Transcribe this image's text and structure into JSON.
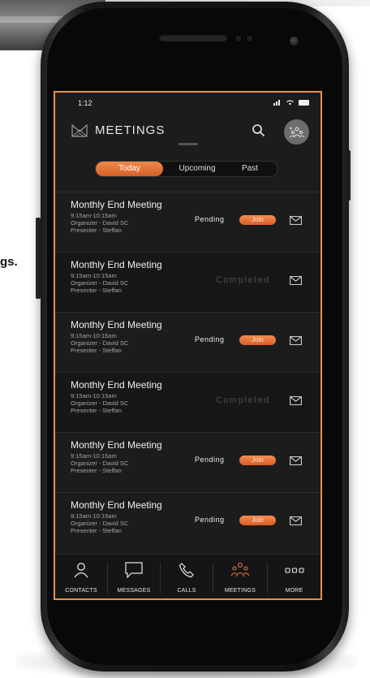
{
  "background": {
    "side_text": "gs."
  },
  "status_bar": {
    "time": "1:12"
  },
  "header": {
    "title": "MEETINGS"
  },
  "tabs": [
    {
      "label": "Today"
    },
    {
      "label": "Upcoming"
    },
    {
      "label": "Past"
    }
  ],
  "meetings": [
    {
      "title": "Monthly End Meeting",
      "time": "9:15am-10:15am",
      "organizer": "Organizer - David SC",
      "presenter": "Presenter - Steffan",
      "status": "Pending",
      "action": "Join"
    },
    {
      "title": "Monthly End Meeting",
      "time": "9:15am-10:15am",
      "organizer": "Organizer - David SC",
      "presenter": "Presenter - Steffan",
      "status": "Completed"
    },
    {
      "title": "Monthly End Meeting",
      "time": "9:15am-10:15am",
      "organizer": "Organizer - David SC",
      "presenter": "Presenter - Steffan",
      "status": "Pending",
      "action": "Join"
    },
    {
      "title": "Monthly End Meeting",
      "time": "9:15am-10:15am",
      "organizer": "Organizer - David SC",
      "presenter": "Presenter - Steffan",
      "status": "Completed"
    },
    {
      "title": "Monthly End Meeting",
      "time": "9:15am-10:15am",
      "organizer": "Organizer - David SC",
      "presenter": "Presenter - Steffan",
      "status": "Pending",
      "action": "Join"
    },
    {
      "title": "Monthly End Meeting",
      "time": "9:15am-10:15am",
      "organizer": "Organizer - David SC",
      "presenter": "Presenter - Steffan",
      "status": "Pending",
      "action": "Join"
    }
  ],
  "bottom_nav": [
    {
      "label": "CONTACTS",
      "icon": "person-icon"
    },
    {
      "label": "MESSAGES",
      "icon": "chat-bubble-icon"
    },
    {
      "label": "CALLS",
      "icon": "phone-icon"
    },
    {
      "label": "MEETINGS",
      "icon": "meetings-group-icon",
      "active": true
    },
    {
      "label": "MORE",
      "icon": "more-dots-icon"
    }
  ],
  "colors": {
    "accent": "#e8773a",
    "screen_bg": "#1c1c1c",
    "frame_border": "#e69147"
  }
}
